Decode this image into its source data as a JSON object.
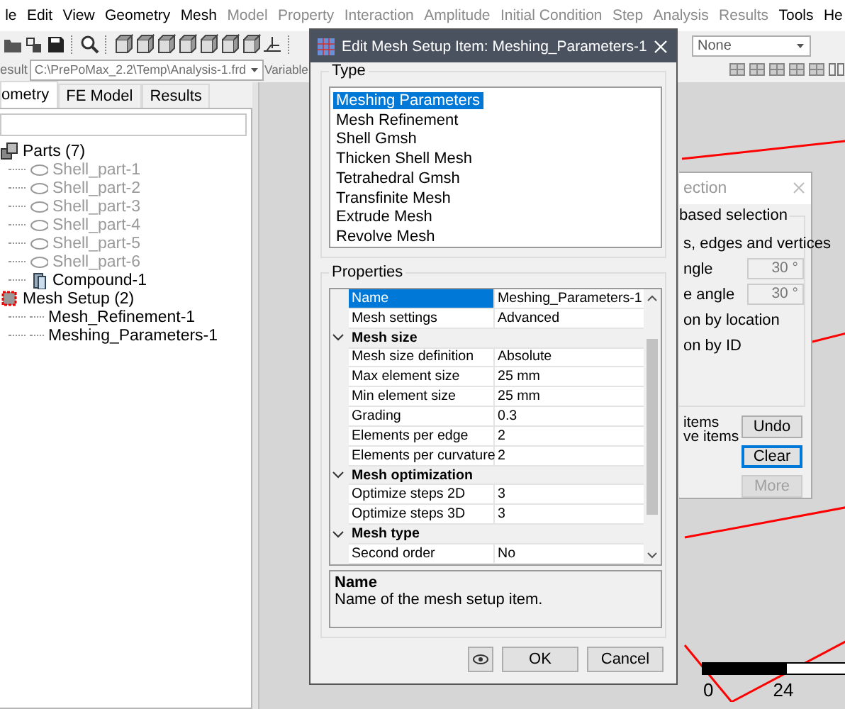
{
  "menu": [
    {
      "label": "le",
      "disabled": false
    },
    {
      "label": "Edit",
      "disabled": false
    },
    {
      "label": "View",
      "disabled": false
    },
    {
      "label": "Geometry",
      "disabled": false
    },
    {
      "label": "Mesh",
      "disabled": false
    },
    {
      "label": "Model",
      "disabled": true
    },
    {
      "label": "Property",
      "disabled": true
    },
    {
      "label": "Interaction",
      "disabled": true
    },
    {
      "label": "Amplitude",
      "disabled": true
    },
    {
      "label": "Initial Condition",
      "disabled": true
    },
    {
      "label": "Step",
      "disabled": true
    },
    {
      "label": "Analysis",
      "disabled": true
    },
    {
      "label": "Results",
      "disabled": true
    },
    {
      "label": "Tools",
      "disabled": false
    },
    {
      "label": "He",
      "disabled": false
    }
  ],
  "view_combo": {
    "value": "None"
  },
  "result_bar": {
    "label": "esult",
    "file": "C:\\PrePoMax_2.2\\Temp\\Analysis-1.frd",
    "variable_label": "Variable"
  },
  "tabs": [
    {
      "label": "ometry",
      "selected": true
    },
    {
      "label": "FE Model",
      "selected": false
    },
    {
      "label": "Results",
      "selected": false
    }
  ],
  "tree": [
    {
      "label": "Parts (7)",
      "kind": "parts",
      "children": [
        {
          "label": "Shell_part-1",
          "kind": "shell",
          "hidden": true
        },
        {
          "label": "Shell_part-2",
          "kind": "shell",
          "hidden": true
        },
        {
          "label": "Shell_part-3",
          "kind": "shell",
          "hidden": true
        },
        {
          "label": "Shell_part-4",
          "kind": "shell",
          "hidden": true
        },
        {
          "label": "Shell_part-5",
          "kind": "shell",
          "hidden": true
        },
        {
          "label": "Shell_part-6",
          "kind": "shell",
          "hidden": true
        },
        {
          "label": "Compound-1",
          "kind": "compound",
          "hidden": false
        }
      ]
    },
    {
      "label": "Mesh Setup (2)",
      "kind": "mesh",
      "children": [
        {
          "label": "Mesh_Refinement-1",
          "kind": "plain",
          "hidden": false
        },
        {
          "label": "Meshing_Parameters-1",
          "kind": "plain",
          "hidden": false
        }
      ]
    }
  ],
  "dialog": {
    "title": "Edit Mesh Setup Item: Meshing_Parameters-1",
    "type_group": "Type",
    "types": [
      {
        "label": "Meshing Parameters",
        "selected": true
      },
      {
        "label": "Mesh Refinement",
        "selected": false
      },
      {
        "label": "Shell Gmsh",
        "selected": false
      },
      {
        "label": "Thicken Shell Mesh",
        "selected": false
      },
      {
        "label": "Tetrahedral Gmsh",
        "selected": false
      },
      {
        "label": "Transfinite Mesh",
        "selected": false
      },
      {
        "label": "Extrude Mesh",
        "selected": false
      },
      {
        "label": "Revolve Mesh",
        "selected": false
      }
    ],
    "properties_group": "Properties",
    "properties": [
      {
        "kind": "row",
        "name": "Name",
        "value": "Meshing_Parameters-1",
        "selected": true
      },
      {
        "kind": "row",
        "name": "Mesh settings",
        "value": "Advanced",
        "selected": false
      },
      {
        "kind": "category",
        "name": "Mesh size",
        "expanded": true
      },
      {
        "kind": "row",
        "name": "Mesh size definition",
        "value": "Absolute",
        "selected": false
      },
      {
        "kind": "row",
        "name": "Max element size",
        "value": "25 mm",
        "selected": false
      },
      {
        "kind": "row",
        "name": "Min element size",
        "value": "25 mm",
        "selected": false
      },
      {
        "kind": "row",
        "name": "Grading",
        "value": "0.3",
        "selected": false
      },
      {
        "kind": "row",
        "name": "Elements per edge",
        "value": "2",
        "selected": false
      },
      {
        "kind": "row",
        "name": "Elements per curvature",
        "value": "2",
        "selected": false
      },
      {
        "kind": "category",
        "name": "Mesh optimization",
        "expanded": true
      },
      {
        "kind": "row",
        "name": "Optimize steps 2D",
        "value": "3",
        "selected": false
      },
      {
        "kind": "row",
        "name": "Optimize steps 3D",
        "value": "3",
        "selected": false
      },
      {
        "kind": "category",
        "name": "Mesh type",
        "expanded": true
      },
      {
        "kind": "row",
        "name": "Second order",
        "value": "No",
        "selected": false
      }
    ],
    "description": {
      "title": "Name",
      "text": "Name of the mesh setup item."
    },
    "buttons": [
      {
        "label": "OK"
      },
      {
        "label": "Cancel"
      }
    ]
  },
  "selection_dialog": {
    "title": "ection",
    "group": "based selection",
    "lines": [
      {
        "kind": "text",
        "label": "s, edges and vertices"
      },
      {
        "kind": "angle",
        "label": "ngle",
        "value": "30 °",
        "disabled": true
      },
      {
        "kind": "angle",
        "label": "e angle",
        "value": "30 °",
        "disabled": true
      },
      {
        "kind": "text",
        "label": "on by location"
      },
      {
        "kind": "text",
        "label": "on by ID"
      }
    ],
    "notes": [
      "items",
      "ve items"
    ],
    "buttons": [
      {
        "label": "Undo",
        "focused": false,
        "disabled": false
      },
      {
        "label": "Clear",
        "focused": true,
        "disabled": false
      },
      {
        "label": "More",
        "focused": false,
        "disabled": true
      }
    ]
  },
  "scale_bar": {
    "labels": [
      "0",
      "24"
    ],
    "level": 0.57
  }
}
